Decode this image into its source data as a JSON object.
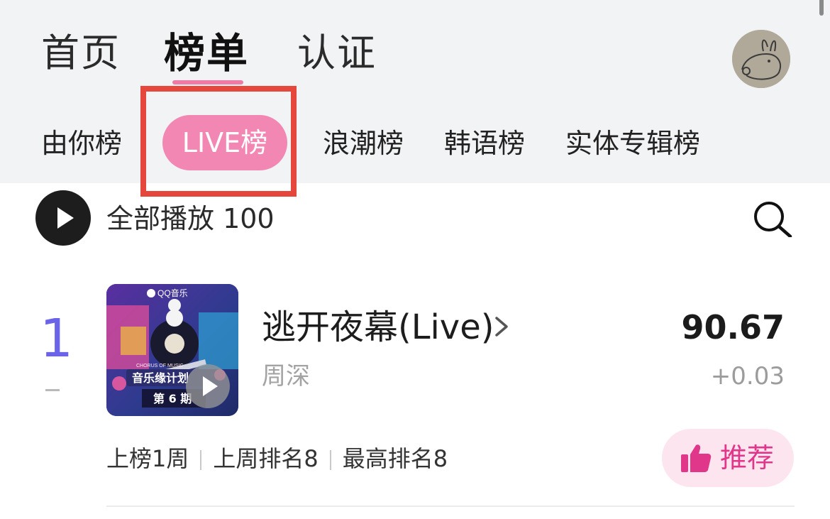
{
  "top_nav": {
    "tabs": [
      {
        "label": "首页",
        "active": false
      },
      {
        "label": "榜单",
        "active": true
      },
      {
        "label": "认证",
        "active": false
      }
    ]
  },
  "sub_nav": {
    "tabs": [
      {
        "label": "由你榜",
        "active": false
      },
      {
        "label": "LIVE榜",
        "active": true
      },
      {
        "label": "浪潮榜",
        "active": false
      },
      {
        "label": "韩语榜",
        "active": false
      },
      {
        "label": "实体专辑榜",
        "active": false
      }
    ]
  },
  "toolbar": {
    "play_all_label": "全部播放 100",
    "play_icon": "play-icon",
    "search_icon": "search-icon"
  },
  "songs": [
    {
      "rank": "1",
      "rank_change": "–",
      "title": "逃开夜幕(Live)",
      "artist": "周深",
      "score": "90.67",
      "delta": "+0.03",
      "weeks_on_chart": "上榜1周",
      "last_week_rank": "上周排名8",
      "peak_rank": "最高排名8",
      "recommend_label": "推荐",
      "cover_texts": {
        "brand": "QQ音乐",
        "show_en": "CHORUS OF MUSIC",
        "show_cn": "音乐缘计划",
        "episode": "第 6 期"
      }
    }
  ],
  "colors": {
    "accent_pink": "#f387b3",
    "highlight_red": "#e5473d",
    "rank_purple": "#6b63e8",
    "recommend_pink": "#e0378a",
    "header_bg": "#f2f3f5"
  }
}
